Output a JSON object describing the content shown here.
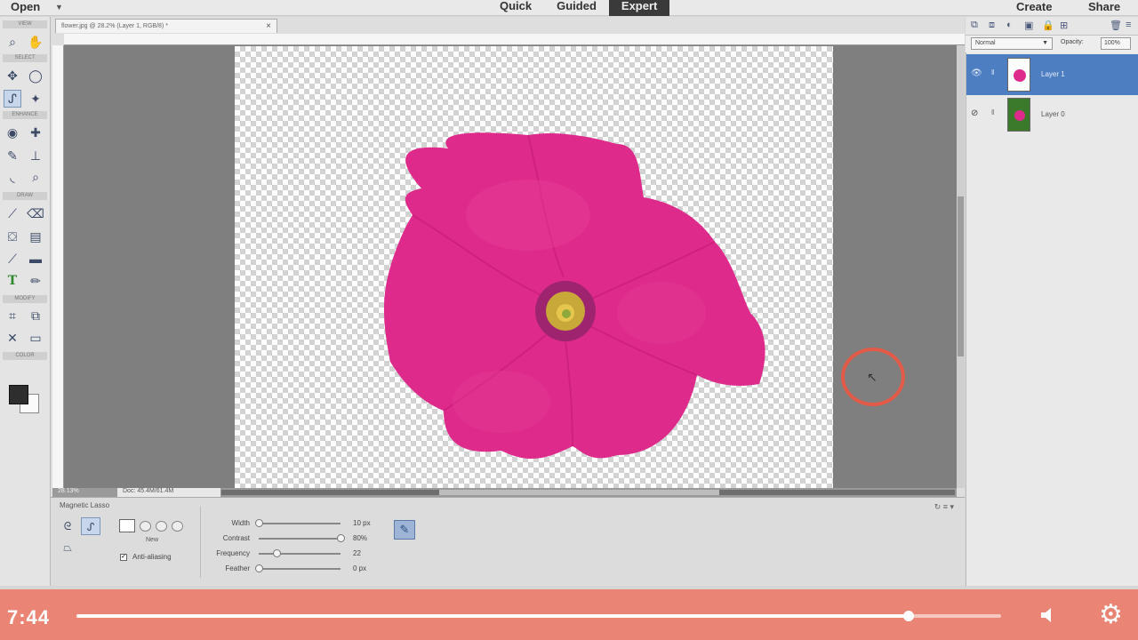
{
  "menubar": {
    "open_label": "Open",
    "modes": [
      "Quick",
      "Guided",
      "Expert"
    ],
    "active_mode": "Expert",
    "create_label": "Create",
    "share_label": "Share"
  },
  "toolbar": {
    "sections": [
      "VIEW",
      "SELECT",
      "ENHANCE",
      "DRAW",
      "MODIFY",
      "COLOR"
    ],
    "active_tool": "magnetic-lasso",
    "foreground_color": "#2e2e2e",
    "background_color": "#fafafa"
  },
  "document": {
    "tab_title": "flower.jpg @ 28.2% (Layer 1, RGB/8) *",
    "status_zoom": "28.13%",
    "status_doc": "Doc: 45.4M/61.4M"
  },
  "tool_options": {
    "title": "Magnetic Lasso",
    "new_label": "New",
    "anti_aliasing_label": "Anti-aliasing",
    "anti_aliasing_checked": true,
    "sliders": [
      {
        "label": "Width",
        "value": "10 px",
        "level": 0.0
      },
      {
        "label": "Contrast",
        "value": "80%",
        "level": 1.0
      },
      {
        "label": "Frequency",
        "value": "22",
        "level": 0.22
      },
      {
        "label": "Feather",
        "value": "0 px",
        "level": 0.0
      }
    ]
  },
  "layers_panel": {
    "blend_mode": "Normal",
    "opacity_label": "Opacity:",
    "opacity_value": "100%",
    "layers": [
      {
        "name": "Layer 1",
        "selected": true
      },
      {
        "name": "Layer 0",
        "selected": false
      }
    ]
  },
  "video_player": {
    "time": "7:44",
    "progress": 0.9,
    "accent_color": "#ec7e6e"
  },
  "colors": {
    "flower": "#e0288c",
    "cursor_ring": "#e25a48",
    "layer_selected": "#4e7ec2"
  }
}
